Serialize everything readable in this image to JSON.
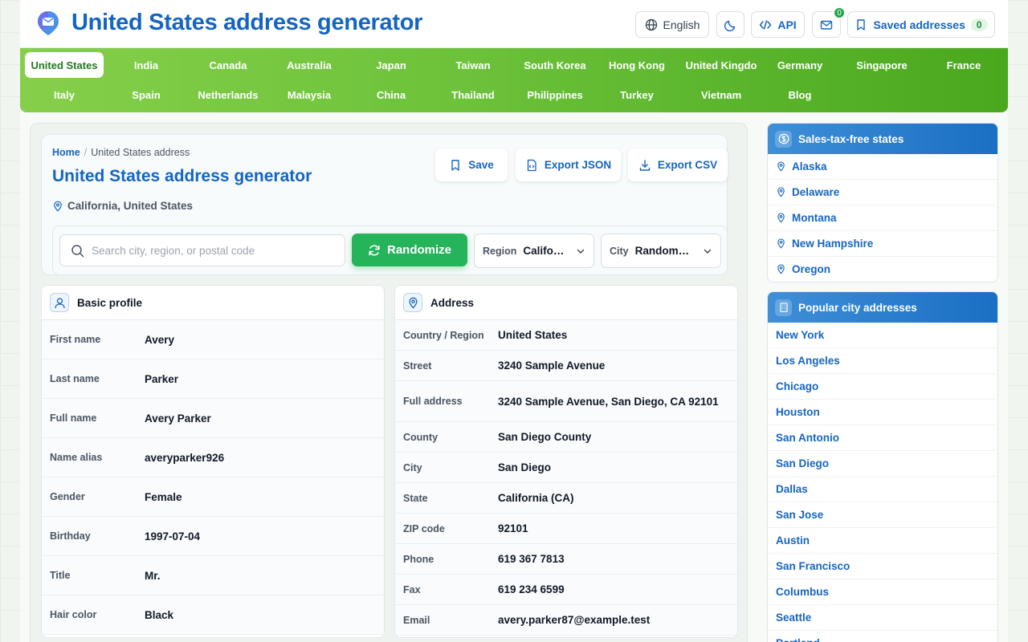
{
  "header": {
    "title": "United States address generator",
    "language_label": "English",
    "api_label": "API",
    "mail_badge": "0",
    "saved_label": "Saved addresses",
    "saved_count": "0"
  },
  "countries": [
    [
      "United States",
      "India",
      "Canada",
      "Australia",
      "Japan",
      "Taiwan",
      "South Korea",
      "Hong Kong",
      "United Kingdo",
      "Germany",
      "Singapore",
      "France"
    ],
    [
      "Italy",
      "Spain",
      "Netherlands",
      "Malaysia",
      "China",
      "Thailand",
      "Philippines",
      "Turkey",
      "Vietnam",
      "Blog"
    ]
  ],
  "active_country": "United States",
  "breadcrumb": {
    "home": "Home",
    "current": "United States address"
  },
  "page": {
    "title": "United States address generator",
    "location": "California, United States"
  },
  "actions": {
    "save": "Save",
    "export_json": "Export JSON",
    "export_csv": "Export CSV"
  },
  "toolbar": {
    "search_placeholder": "Search city, region, or postal code",
    "randomize": "Randomize",
    "region_label": "Region",
    "region_value": "California",
    "city_label": "City",
    "city_value": "Random city"
  },
  "basic_profile": {
    "title": "Basic profile",
    "rows": [
      {
        "k": "First name",
        "v": "Avery"
      },
      {
        "k": "Last name",
        "v": "Parker"
      },
      {
        "k": "Full name",
        "v": "Avery Parker"
      },
      {
        "k": "Name alias",
        "v": "averyparker926"
      },
      {
        "k": "Gender",
        "v": "Female"
      },
      {
        "k": "Birthday",
        "v": "1997-07-04"
      },
      {
        "k": "Title",
        "v": "Mr."
      },
      {
        "k": "Hair color",
        "v": "Black"
      }
    ]
  },
  "address": {
    "title": "Address",
    "rows": [
      {
        "k": "Country / Region",
        "v": "United States"
      },
      {
        "k": "Street",
        "v": "3240 Sample Avenue"
      },
      {
        "k": "Full address",
        "v": "3240 Sample Avenue, San Diego, CA 92101"
      },
      {
        "k": "County",
        "v": "San Diego County"
      },
      {
        "k": "City",
        "v": "San Diego"
      },
      {
        "k": "State",
        "v": "California (CA)"
      },
      {
        "k": "ZIP code",
        "v": "92101"
      },
      {
        "k": "Phone",
        "v": "619 367 7813"
      },
      {
        "k": "Fax",
        "v": "619 234 6599"
      },
      {
        "k": "Email",
        "v": "avery.parker87@example.test"
      }
    ]
  },
  "sidebar": {
    "tax_free": {
      "title": "Sales-tax-free states",
      "items": [
        "Alaska",
        "Delaware",
        "Montana",
        "New Hampshire",
        "Oregon"
      ]
    },
    "popular": {
      "title": "Popular city addresses",
      "items": [
        "New York",
        "Los Angeles",
        "Chicago",
        "Houston",
        "San Antonio",
        "San Diego",
        "Dallas",
        "San Jose",
        "Austin",
        "San Francisco",
        "Columbus",
        "Seattle",
        "Portland"
      ]
    }
  },
  "colors": {
    "brand_blue": "#1565c0",
    "nav_green": "#6cc23a",
    "randomize_green": "#25b45a"
  }
}
